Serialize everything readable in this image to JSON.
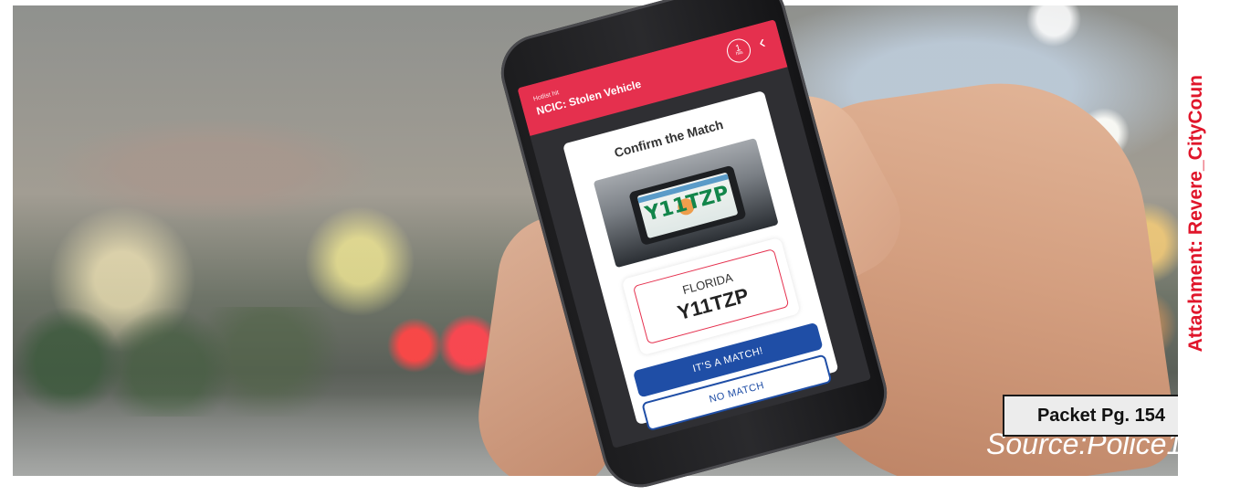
{
  "app": {
    "header_kicker": "Hotlist hit",
    "header_title": "NCIC: Stolen Vehicle",
    "hit_count": "1",
    "hit_count_unit": "hits",
    "back_icon": "chevron-left-icon"
  },
  "card": {
    "title": "Confirm the Match",
    "plate_photo_text": "Y11TZP",
    "plate_state": "FLORIDA",
    "plate_number": "Y11TZP",
    "match_button": "IT'S A MATCH!",
    "no_match_button": "NO MATCH"
  },
  "document": {
    "packet_label": "Packet Pg. 154",
    "attachment_label": "Attachment: Revere_CityCoun",
    "source_caption": "Source:Police1"
  },
  "colors": {
    "header_red": "#e5304e",
    "match_blue": "#1f4ea6",
    "attachment_red": "#e0162b"
  }
}
